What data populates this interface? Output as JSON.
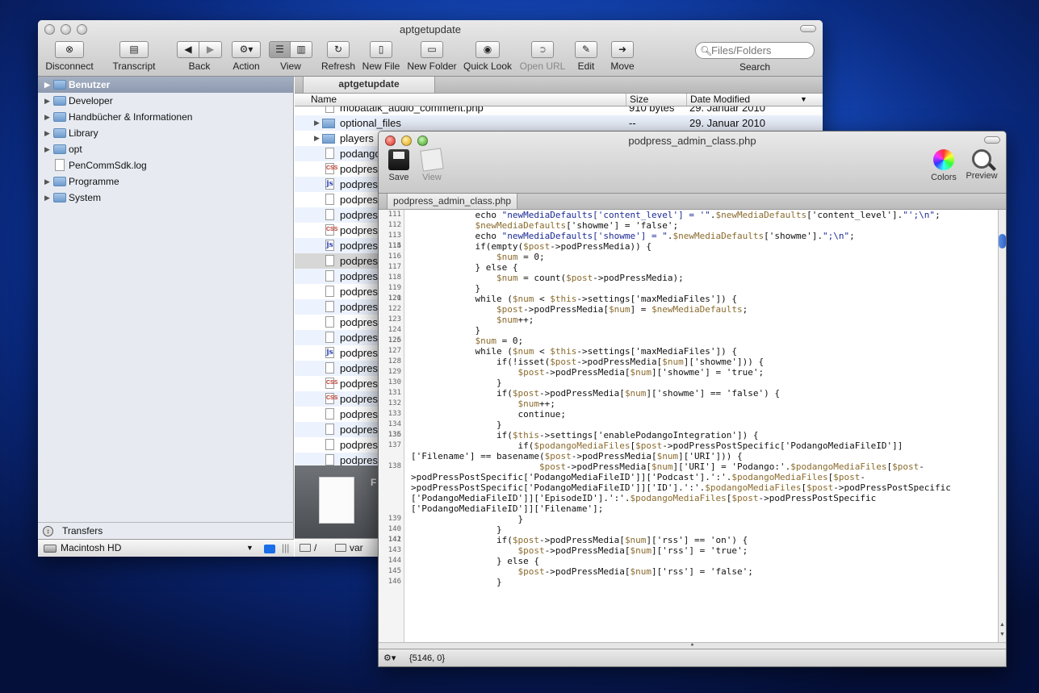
{
  "finder": {
    "title": "aptgetupdate",
    "toolbar": {
      "disconnect": "Disconnect",
      "transcript": "Transcript",
      "back": "Back",
      "action": "Action",
      "view": "View",
      "refresh": "Refresh",
      "new_file": "New File",
      "new_folder": "New Folder",
      "quick_look": "Quick Look",
      "open_url": "Open URL",
      "edit": "Edit",
      "move": "Move",
      "search_placeholder": "Files/Folders",
      "search_label": "Search"
    },
    "sidebar": [
      {
        "label": "Benutzer",
        "selected": true,
        "icon": "folder-icon"
      },
      {
        "label": "Developer",
        "icon": "folder-icon"
      },
      {
        "label": "Handbücher & Informationen",
        "icon": "folder-icon"
      },
      {
        "label": "Library",
        "icon": "folder-icon"
      },
      {
        "label": "opt",
        "icon": "folder-icon"
      },
      {
        "label": "PenCommSdk.log",
        "icon": "document-icon"
      },
      {
        "label": "Programme",
        "icon": "folder-icon"
      },
      {
        "label": "System",
        "icon": "folder-icon"
      }
    ],
    "transfers": "Transfers",
    "volume": "Macintosh HD",
    "tab": "aptgetupdate",
    "columns": {
      "name": "Name",
      "size": "Size",
      "date": "Date Modified"
    },
    "files": [
      {
        "name": "mobatalk_audio_comment.php",
        "size": "910 bytes",
        "date": "29. Januar 2010",
        "type": "doc"
      },
      {
        "name": "optional_files",
        "size": "--",
        "date": "29. Januar 2010",
        "type": "folder"
      },
      {
        "name": "players",
        "size": "",
        "date": "",
        "type": "folder"
      },
      {
        "name": "podango",
        "size": "",
        "date": "",
        "type": "doc"
      },
      {
        "name": "podpres",
        "size": "",
        "date": "",
        "type": "css"
      },
      {
        "name": "podpres",
        "size": "",
        "date": "",
        "type": "js"
      },
      {
        "name": "podpres",
        "size": "",
        "date": "",
        "type": "doc"
      },
      {
        "name": "podpres",
        "size": "",
        "date": "",
        "type": "doc"
      },
      {
        "name": "podpres",
        "size": "",
        "date": "",
        "type": "css"
      },
      {
        "name": "podpres",
        "size": "",
        "date": "",
        "type": "js"
      },
      {
        "name": "podpres",
        "size": "",
        "date": "",
        "type": "doc",
        "selected": true
      },
      {
        "name": "podpres",
        "size": "",
        "date": "",
        "type": "doc"
      },
      {
        "name": "podpres",
        "size": "",
        "date": "",
        "type": "doc"
      },
      {
        "name": "podpres",
        "size": "",
        "date": "",
        "type": "doc"
      },
      {
        "name": "podpres",
        "size": "",
        "date": "",
        "type": "doc"
      },
      {
        "name": "podpres",
        "size": "",
        "date": "",
        "type": "doc"
      },
      {
        "name": "podpres",
        "size": "",
        "date": "",
        "type": "js"
      },
      {
        "name": "podpres",
        "size": "",
        "date": "",
        "type": "doc"
      },
      {
        "name": "podpres",
        "size": "",
        "date": "",
        "type": "css"
      },
      {
        "name": "podpres",
        "size": "",
        "date": "",
        "type": "css"
      },
      {
        "name": "podpres",
        "size": "",
        "date": "",
        "type": "doc"
      },
      {
        "name": "podpres",
        "size": "",
        "date": "",
        "type": "doc"
      },
      {
        "name": "podpres",
        "size": "",
        "date": "",
        "type": "doc"
      },
      {
        "name": "podpres",
        "size": "",
        "date": "",
        "type": "doc"
      }
    ],
    "preview_initial": "F",
    "path": [
      "/",
      "var"
    ]
  },
  "editor": {
    "title": "podpress_admin_class.php",
    "tab": "podpress_admin_class.php",
    "toolbar": {
      "save": "Save",
      "view": "View",
      "colors": "Colors",
      "preview": "Preview"
    },
    "status": "{5146, 0}",
    "lines": [
      {
        "n": "111",
        "t": "            echo \"newMediaDefaults['content_level'] = '\".$newMediaDefaults['content_level'].\"';\\n\";"
      },
      {
        "n": "112",
        "t": "            $newMediaDefaults['showme'] = 'false';"
      },
      {
        "n": "113",
        "t": "            echo \"newMediaDefaults['showme'] = \".$newMediaDefaults['showme'].\";\\n\";"
      },
      {
        "n": "114",
        "t": ""
      },
      {
        "n": "115",
        "t": "            if(empty($post->podPressMedia)) {"
      },
      {
        "n": "116",
        "t": "                $num = 0;"
      },
      {
        "n": "117",
        "t": "            } else {"
      },
      {
        "n": "118",
        "t": "                $num = count($post->podPressMedia);"
      },
      {
        "n": "119",
        "t": "            }"
      },
      {
        "n": "120",
        "t": ""
      },
      {
        "n": "121",
        "t": "            while ($num < $this->settings['maxMediaFiles']) {"
      },
      {
        "n": "122",
        "t": "                $post->podPressMedia[$num] = $newMediaDefaults;"
      },
      {
        "n": "123",
        "t": "                $num++;"
      },
      {
        "n": "124",
        "t": "            }"
      },
      {
        "n": "125",
        "t": ""
      },
      {
        "n": "126",
        "t": "            $num = 0;"
      },
      {
        "n": "127",
        "t": "            while ($num < $this->settings['maxMediaFiles']) {"
      },
      {
        "n": "128",
        "t": "                if(!isset($post->podPressMedia[$num]['showme'])) {"
      },
      {
        "n": "129",
        "t": "                    $post->podPressMedia[$num]['showme'] = 'true';"
      },
      {
        "n": "130",
        "t": "                }"
      },
      {
        "n": "131",
        "t": "                if($post->podPressMedia[$num]['showme'] == 'false') {"
      },
      {
        "n": "132",
        "t": "                    $num++;"
      },
      {
        "n": "133",
        "t": "                    continue;"
      },
      {
        "n": "134",
        "t": "                }"
      },
      {
        "n": "135",
        "t": ""
      },
      {
        "n": "136",
        "t": "                if($this->settings['enablePodangoIntegration']) {"
      },
      {
        "n": "137",
        "t": "                    if($podangoMediaFiles[$post->podPressPostSpecific['PodangoMediaFileID']]"
      },
      {
        "n": "",
        "t": "['Filename'] == basename($post->podPressMedia[$num]['URI'])) {"
      },
      {
        "n": "138",
        "t": "                        $post->podPressMedia[$num]['URI'] = 'Podango:'.$podangoMediaFiles[$post-"
      },
      {
        "n": "",
        "t": ">podPressPostSpecific['PodangoMediaFileID']]['Podcast'].':'.$podangoMediaFiles[$post-"
      },
      {
        "n": "",
        "t": ">podPressPostSpecific['PodangoMediaFileID']]['ID'].':'.$podangoMediaFiles[$post->podPressPostSpecific"
      },
      {
        "n": "",
        "t": "['PodangoMediaFileID']]['EpisodeID'].':'.$podangoMediaFiles[$post->podPressPostSpecific"
      },
      {
        "n": "",
        "t": "['PodangoMediaFileID']]['Filename'];"
      },
      {
        "n": "139",
        "t": "                    }"
      },
      {
        "n": "140",
        "t": "                }"
      },
      {
        "n": "141",
        "t": ""
      },
      {
        "n": "142",
        "t": "                if($post->podPressMedia[$num]['rss'] == 'on') {"
      },
      {
        "n": "143",
        "t": "                    $post->podPressMedia[$num]['rss'] = 'true';"
      },
      {
        "n": "144",
        "t": "                } else {"
      },
      {
        "n": "145",
        "t": "                    $post->podPressMedia[$num]['rss'] = 'false';"
      },
      {
        "n": "146",
        "t": "                }"
      }
    ]
  }
}
